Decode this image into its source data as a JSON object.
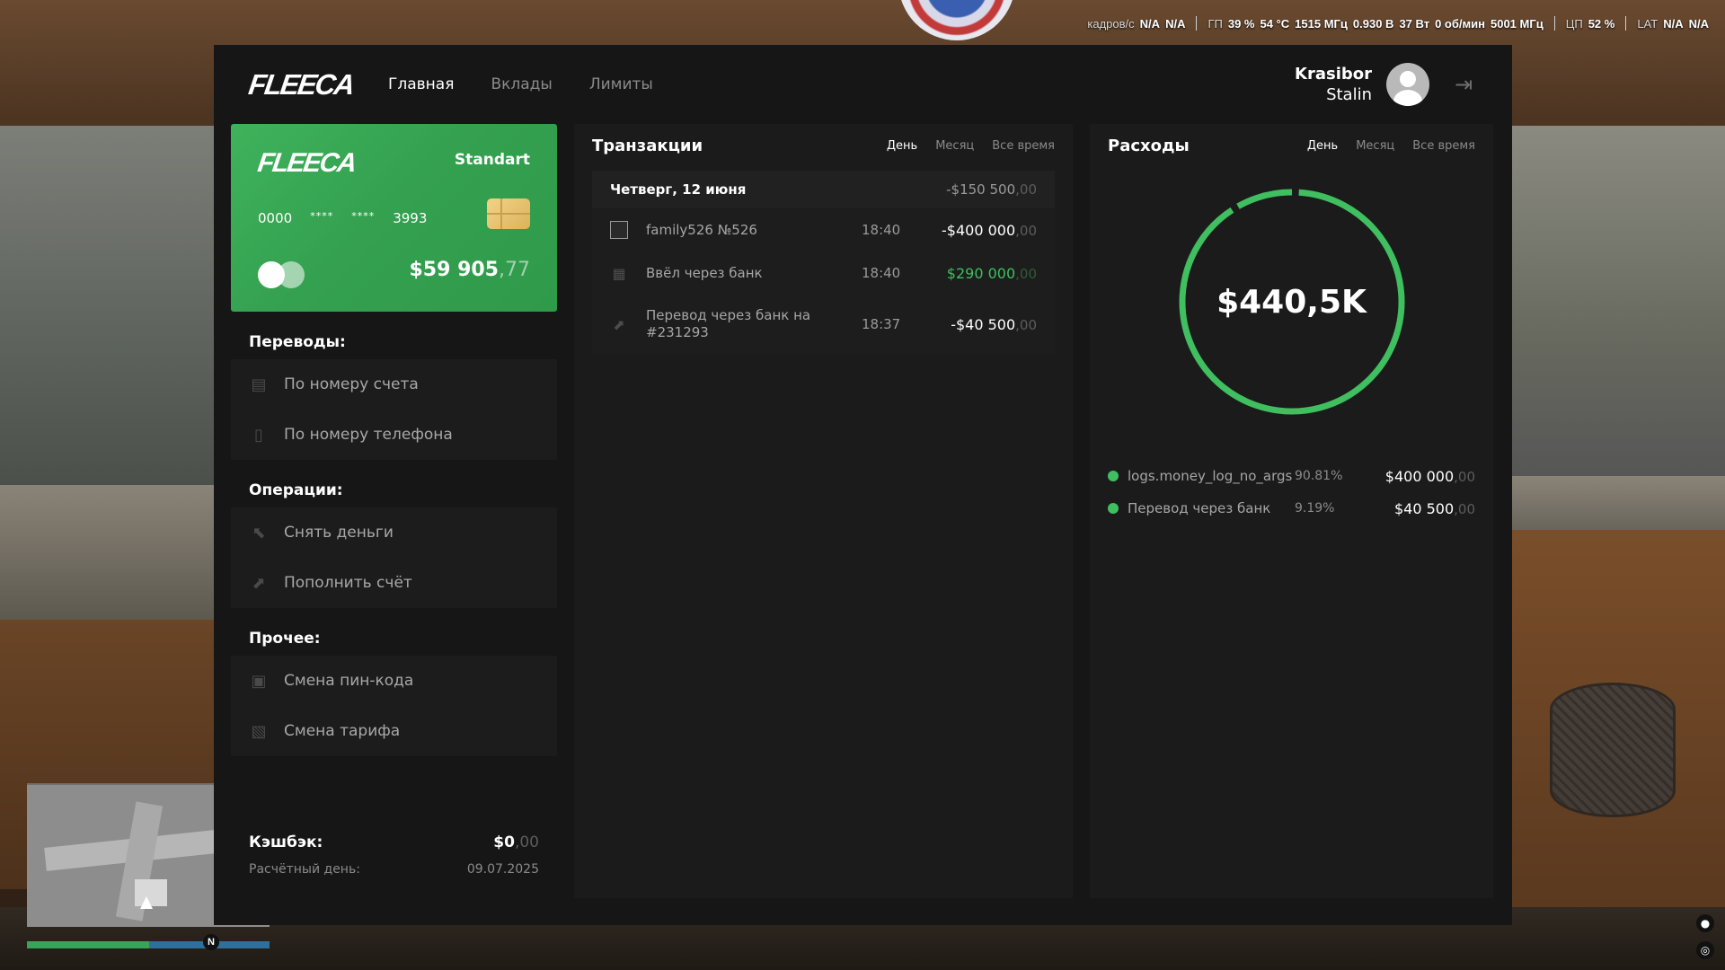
{
  "hud": {
    "fps_label": "кадров/с",
    "fps_v1": "N/A",
    "fps_v2": "N/A",
    "gpu_label": "ГП",
    "gpu_load": "39 %",
    "gpu_temp": "54 °C",
    "gpu_clock": "1515 МГц",
    "gpu_volt": "0.930 В",
    "gpu_power": "37 Вт",
    "gpu_fan": "0 об/мин",
    "gpu_mem": "5001 МГц",
    "cpu_label": "ЦП",
    "cpu_load": "52 %",
    "lat_label": "LAT",
    "lat_v1": "N/A",
    "lat_v2": "N/A",
    "compass": "N"
  },
  "app": {
    "logo": "FLEECA",
    "nav": [
      "Главная",
      "Вклады",
      "Лимиты"
    ],
    "user": {
      "first_name": "Krasibor",
      "last_name": "Stalin"
    }
  },
  "card": {
    "logo": "FLEECA",
    "tier": "Standart",
    "number": [
      "0000",
      "****",
      "****",
      "3993"
    ],
    "balance_main": "$59 905",
    "balance_cents": ",77",
    "accent": "#3fb25c"
  },
  "menu": {
    "transfers_title": "Переводы:",
    "transfers": [
      {
        "label": "По номеру счета",
        "icon": "card-icon"
      },
      {
        "label": "По номеру телефона",
        "icon": "phone-icon"
      }
    ],
    "operations_title": "Операции:",
    "operations": [
      {
        "label": "Снять деньги",
        "icon": "arrow-down-left-icon"
      },
      {
        "label": "Пополнить счёт",
        "icon": "arrow-up-left-icon"
      }
    ],
    "other_title": "Прочее:",
    "other": [
      {
        "label": "Смена пин-кода",
        "icon": "lock-icon"
      },
      {
        "label": "Смена тарифа",
        "icon": "document-icon"
      }
    ]
  },
  "cashback": {
    "label": "Кэшбэк:",
    "value_main": "$0",
    "value_cents": ",00"
  },
  "payday": {
    "label": "Расчётный день:",
    "value": "09.07.2025"
  },
  "transactions": {
    "title": "Транзакции",
    "filters": [
      "День",
      "Месяц",
      "Все время"
    ],
    "active_filter": "День",
    "date_header": {
      "date": "Четверг, 12 июня",
      "total_main": "-$150 500",
      "total_cents": ",00"
    },
    "rows": [
      {
        "name": "family526 №526",
        "time": "18:40",
        "amount_main": "-$400 000",
        "amount_cents": ",00",
        "positive": false,
        "icon": "image-icon"
      },
      {
        "name": "Ввёл через банк",
        "time": "18:40",
        "amount_main": "$290 000",
        "amount_cents": ",00",
        "positive": true,
        "icon": "qr-icon"
      },
      {
        "name": "Перевод через банк на #231293",
        "time": "18:37",
        "amount_main": "-$40 500",
        "amount_cents": ",00",
        "positive": false,
        "icon": "arrow-up-left-icon"
      }
    ]
  },
  "expenses": {
    "title": "Расходы",
    "filters": [
      "День",
      "Месяц",
      "Все время"
    ],
    "active_filter": "День",
    "total": "$440,5K",
    "accent": "#3fbf5f",
    "items": [
      {
        "name": "logs.money_log_no_args",
        "pct": "90.81%",
        "share": 0.9081,
        "amount_main": "$400 000",
        "amount_cents": ",00",
        "color": "#3fbf5f"
      },
      {
        "name": "Перевод через банк",
        "pct": "9.19%",
        "share": 0.0919,
        "amount_main": "$40 500",
        "amount_cents": ",00",
        "color": "#3fbf5f"
      }
    ]
  }
}
